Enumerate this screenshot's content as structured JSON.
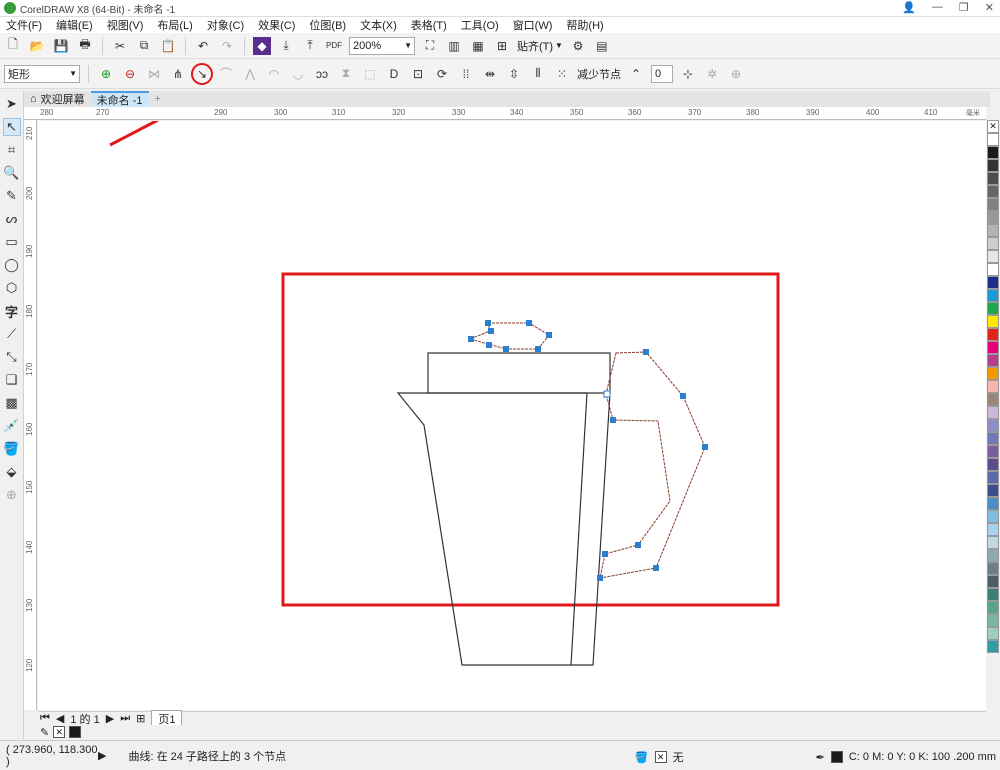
{
  "window": {
    "title": "CorelDRAW X8 (64-Bit) - 未命名 -1"
  },
  "menu": [
    "文件(F)",
    "编辑(E)",
    "视图(V)",
    "布局(L)",
    "对象(C)",
    "效果(C)",
    "位图(B)",
    "文本(X)",
    "表格(T)",
    "工具(O)",
    "窗口(W)",
    "帮助(H)"
  ],
  "toolbar1": {
    "zoom": "200%",
    "snap_label": "贴齐(T)"
  },
  "toolbar2": {
    "object_type": "矩形",
    "reduce_nodes_label": "减少节点",
    "curve_smoothness": "0"
  },
  "tabs": {
    "welcome": "欢迎屏幕",
    "document": "未命名 -1",
    "add": "+"
  },
  "ruler": {
    "h_ticks": [
      "280",
      "270",
      "290",
      "300",
      "310",
      "320",
      "330",
      "340",
      "350",
      "360",
      "370",
      "380",
      "390",
      "400",
      "410"
    ],
    "unit": "毫米",
    "v_ticks": [
      "210",
      "200",
      "190",
      "180",
      "170",
      "160",
      "150",
      "140",
      "130",
      "120"
    ]
  },
  "page_nav": {
    "page_of": "1 的 1",
    "page_tab": "页1"
  },
  "status": {
    "coords": "( 273.960, 118.300 )",
    "info": "曲线: 在 24 子路径上的 3 个节点",
    "fill_none": "无",
    "outline_info": "C: 0 M: 0 Y: 0 K: 100  .200 mm"
  },
  "colors": {
    "palette": [
      "#ffffff",
      "#1a1a1a",
      "#333333",
      "#4d4d4d",
      "#666666",
      "#808080",
      "#999999",
      "#b3b3b3",
      "#cccccc",
      "#e6e6e6",
      "#ffffff",
      "#1f2d8a",
      "#1a9ad6",
      "#1fa84a",
      "#ffe600",
      "#e2231a",
      "#e5007e",
      "#b43d8c",
      "#f39800",
      "#f6b6b0",
      "#9b8579",
      "#c9b8d8",
      "#8f8fc7",
      "#6f79b8",
      "#7a5da0",
      "#5e4a8f",
      "#5a6ba7",
      "#3b4e89",
      "#4a8ec9",
      "#7fbde3",
      "#a6d2ec",
      "#bfd9df",
      "#8fa9b0",
      "#6a7f86",
      "#4b5e66",
      "#3e7f73",
      "#5aa38f",
      "#78b7a2",
      "#9ecdb8",
      "#2f9ea2"
    ],
    "selection_node": "#2b7fd0",
    "highlight_red": "#e0181b"
  }
}
